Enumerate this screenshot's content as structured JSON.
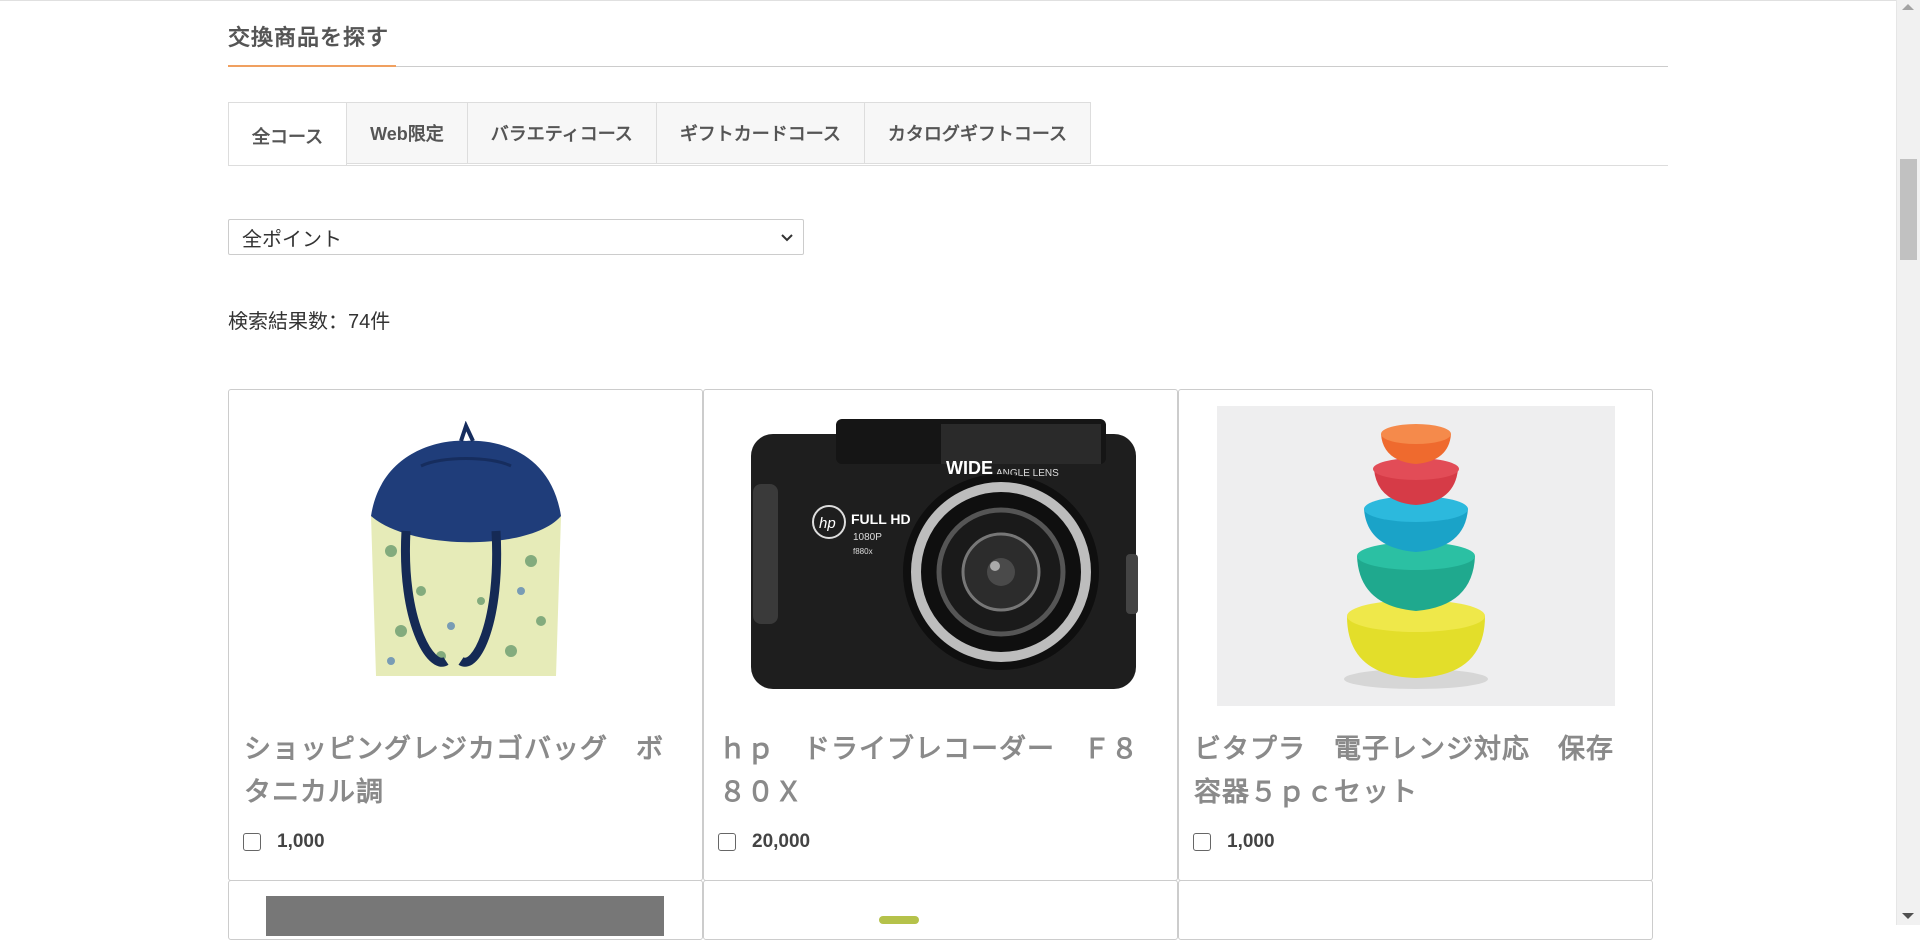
{
  "section": {
    "title": "交換商品を探す"
  },
  "tabs": [
    {
      "label": "全コース",
      "active": true
    },
    {
      "label": "Web限定"
    },
    {
      "label": "バラエティコース"
    },
    {
      "label": "ギフトカードコース"
    },
    {
      "label": "カタログギフトコース"
    }
  ],
  "filter": {
    "selected": "全ポイント"
  },
  "results": {
    "count_text": "検索結果数：74件"
  },
  "products": [
    {
      "name": "ショッピングレジカゴバッグ　ボタニカル調",
      "points": "1,000",
      "icon": "shopping-bag-image"
    },
    {
      "name": "ｈｐ　ドライブレコーダー　Ｆ８８０Ｘ",
      "points": "20,000",
      "icon": "dashcam-image"
    },
    {
      "name": "ビタプラ　電子レンジ対応　保存容器５ｐｃセット",
      "points": "1,000",
      "icon": "food-container-image"
    }
  ],
  "colors": {
    "accent": "#f0a060",
    "tab_bg": "#f7f7f7",
    "name_text": "#8a8a8a"
  }
}
